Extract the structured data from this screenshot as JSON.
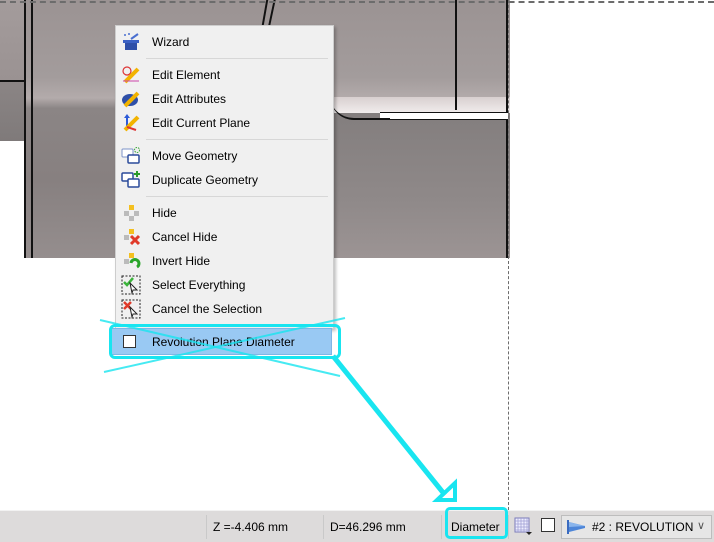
{
  "context_menu": {
    "items": [
      {
        "label": "Wizard",
        "icon": "wizard-hat-icon"
      },
      {
        "label": "Edit Element",
        "icon": "edit-element-pencil-icon"
      },
      {
        "label": "Edit Attributes",
        "icon": "edit-attributes-pencil-icon"
      },
      {
        "label": "Edit Current Plane",
        "icon": "edit-plane-pencil-icon"
      },
      {
        "label": "Move Geometry",
        "icon": "move-geometry-icon"
      },
      {
        "label": "Duplicate Geometry",
        "icon": "duplicate-geometry-icon"
      },
      {
        "label": "Hide",
        "icon": "hide-icon"
      },
      {
        "label": "Cancel Hide",
        "icon": "cancel-hide-icon"
      },
      {
        "label": "Invert Hide",
        "icon": "invert-hide-icon"
      },
      {
        "label": "Select Everything",
        "icon": "select-all-icon"
      },
      {
        "label": "Cancel the Selection",
        "icon": "cancel-selection-icon"
      }
    ],
    "checkbox_item": {
      "label": "Revolution Plane Diameter",
      "checked": false,
      "highlighted": true
    }
  },
  "status_bar": {
    "z_value": "Z =-4.406 mm",
    "d_value": "D=46.296 mm",
    "mode_label": "Diameter",
    "grid_icon": "grid-snap-icon",
    "checkbox_checked": false,
    "plane_combo": {
      "value": "#2 : REVOLUTION",
      "icon": "revolution-plane-icon"
    }
  },
  "annotations": {
    "color": "#19e5f0"
  }
}
